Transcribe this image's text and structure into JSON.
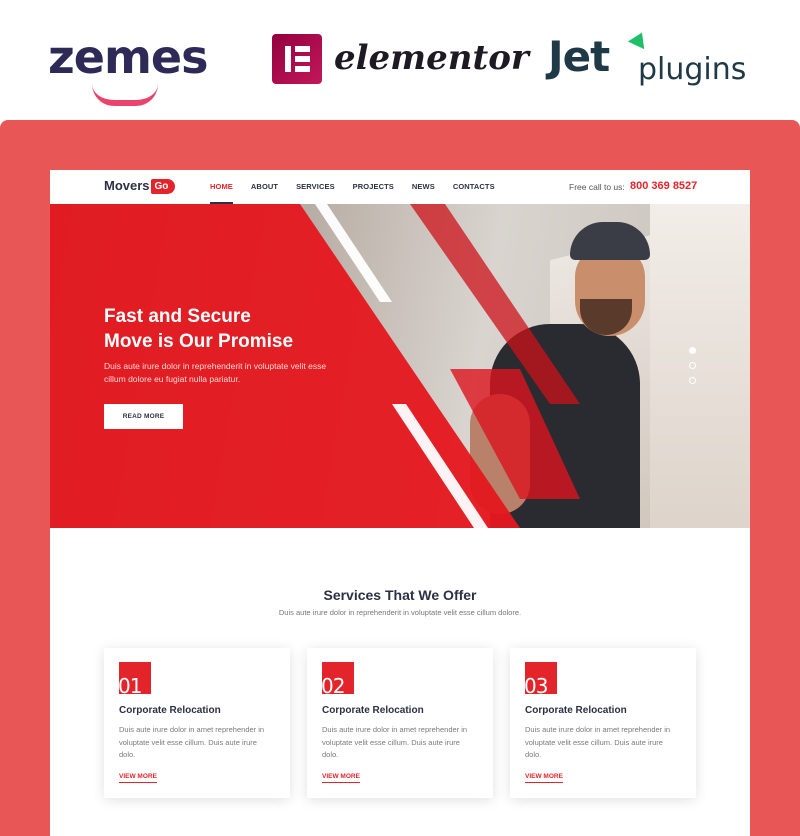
{
  "brands": {
    "zemes": "zemes",
    "elementor": "elementor",
    "jet": "Jet",
    "plugins": "plugins"
  },
  "site": {
    "logo": {
      "text": "Movers",
      "badge": "Go"
    },
    "nav": [
      "HOME",
      "ABOUT",
      "SERVICES",
      "PROJECTS",
      "NEWS",
      "CONTACTS"
    ],
    "call_label": "Free call to us:",
    "call_number": "800 369 8527",
    "hero": {
      "title_line1": "Fast and Secure",
      "title_line2": "Move is Our Promise",
      "text": "Duis aute irure dolor in reprehenderit in voluptate velit esse cillum dolore eu fugiat nulla pariatur.",
      "button": "READ MORE",
      "slides": 3,
      "active_slide": 1
    },
    "services": {
      "title": "Services That We Offer",
      "subtitle": "Duis aute irure dolor in reprehenderit in voluptate velit esse cillum dolore.",
      "cards": [
        {
          "num": "01",
          "title": "Corporate Relocation",
          "text": "Duis aute irure dolor in  amet reprehender in voluptate velit esse cillum. Duis aute irure dolo.",
          "more": "VIEW MORE"
        },
        {
          "num": "02",
          "title": "Corporate Relocation",
          "text": "Duis aute irure dolor in  amet reprehender in voluptate velit esse cillum. Duis aute irure dolo.",
          "more": "VIEW MORE"
        },
        {
          "num": "03",
          "title": "Corporate Relocation",
          "text": "Duis aute irure dolor in  amet reprehender in voluptate velit esse cillum. Duis aute irure dolo.",
          "more": "VIEW MORE"
        }
      ]
    }
  },
  "colors": {
    "frame": "#e85656",
    "accent": "#e3242b",
    "dark": "#2e2f45"
  }
}
